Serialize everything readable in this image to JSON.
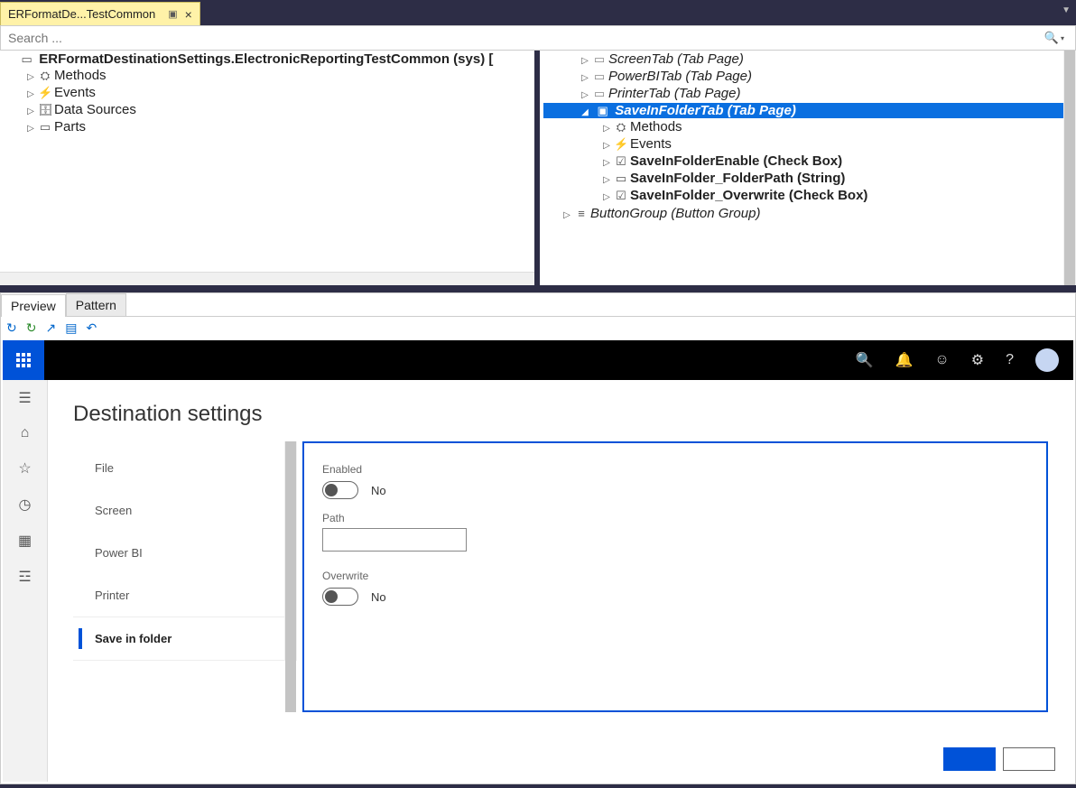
{
  "docTab": {
    "title": "ERFormatDe...TestCommon"
  },
  "search": {
    "placeholder": "Search ..."
  },
  "leftTree": {
    "root": "ERFormatDestinationSettings.ElectronicReportingTestCommon (sys) [",
    "methods": "Methods",
    "events": "Events",
    "dataSources": "Data Sources",
    "parts": "Parts"
  },
  "rightTree": {
    "screenTab": "ScreenTab (Tab Page)",
    "powerBI": "PowerBITab (Tab Page)",
    "printer": "PrinterTab (Tab Page)",
    "saveInFolder": "SaveInFolderTab (Tab Page)",
    "methods": "Methods",
    "events": "Events",
    "enable": "SaveInFolderEnable (Check Box)",
    "path": "SaveInFolder_FolderPath (String)",
    "overwrite": "SaveInFolder_Overwrite (Check Box)",
    "buttonGroup": "ButtonGroup (Button Group)"
  },
  "panelTabs": {
    "preview": "Preview",
    "pattern": "Pattern"
  },
  "preview": {
    "title": "Destination settings",
    "tabs": {
      "file": "File",
      "screen": "Screen",
      "powerbi": "Power BI",
      "printer": "Printer",
      "saveInFolder": "Save in folder"
    },
    "fields": {
      "enabledLabel": "Enabled",
      "enabledValue": "No",
      "pathLabel": "Path",
      "pathValue": "",
      "overwriteLabel": "Overwrite",
      "overwriteValue": "No"
    }
  }
}
